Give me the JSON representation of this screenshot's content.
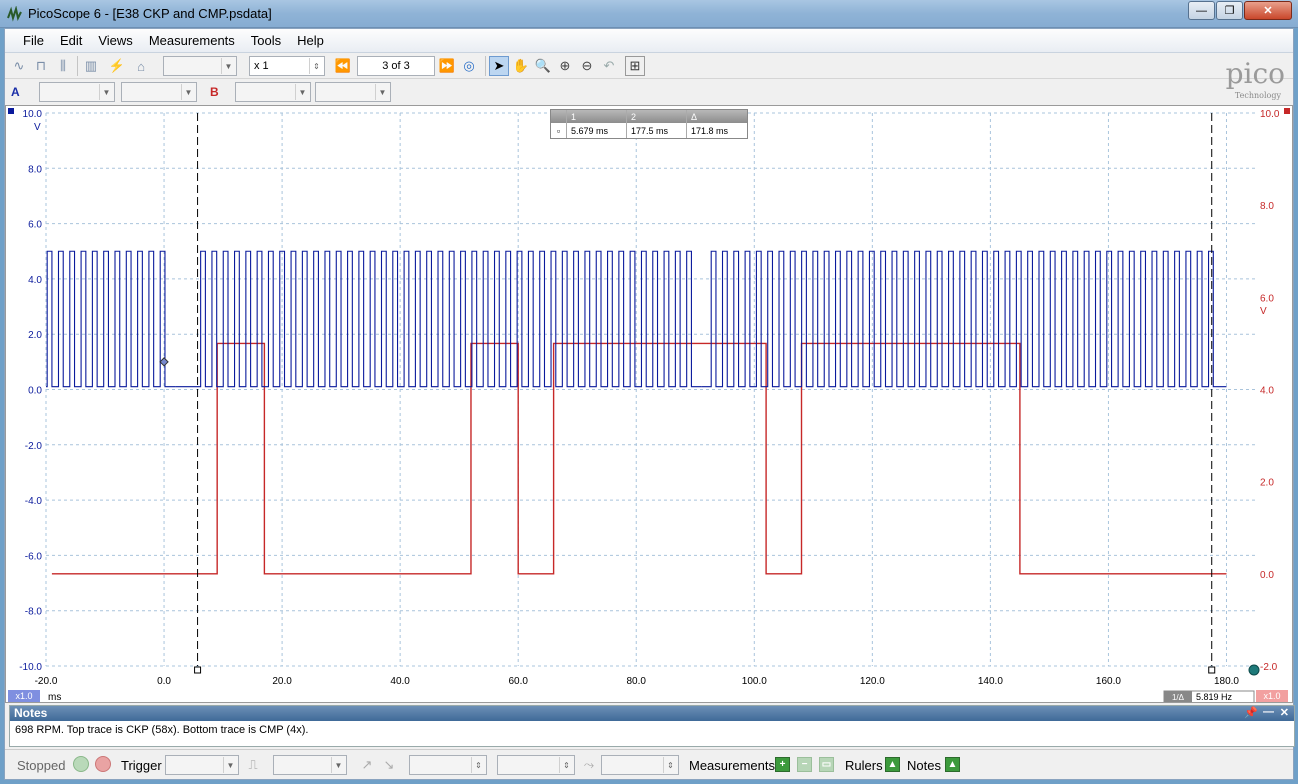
{
  "window": {
    "title": "PicoScope 6 - [E38 CKP and CMP.psdata]",
    "min_label": "—",
    "max_label": "❐",
    "close_label": "✕"
  },
  "menu": [
    "File",
    "Edit",
    "Views",
    "Measurements",
    "Tools",
    "Help"
  ],
  "toolbar1": {
    "zoom_factor": "x 1",
    "buffer_nav": "3 of 3"
  },
  "logo": {
    "word": "pico",
    "sub": "Technology"
  },
  "channels": {
    "a_label": "A",
    "b_label": "B"
  },
  "colors": {
    "channel_a": "#0a1a9c",
    "channel_b": "#c62828",
    "grid": "#a9c4dc"
  },
  "rulers": {
    "headers": [
      "1",
      "2",
      "Δ"
    ],
    "values": [
      "5.679 ms",
      "177.5 ms",
      "171.8 ms"
    ]
  },
  "axes": {
    "left_unit": "V",
    "right_unit": "V",
    "left_ticks": [
      "10.0",
      "8.0",
      "6.0",
      "4.0",
      "2.0",
      "0.0",
      "-2.0",
      "-4.0",
      "-6.0",
      "-8.0",
      "-10.0"
    ],
    "right_ticks": [
      "10.0",
      "8.0",
      "6.0",
      "4.0",
      "2.0",
      "0.0",
      "-2.0"
    ],
    "x_ticks": [
      "-20.0",
      "0.0",
      "20.0",
      "40.0",
      "60.0",
      "80.0",
      "100.0",
      "120.0",
      "140.0",
      "160.0",
      "180.0"
    ],
    "x_unit": "ms",
    "left_scale_badge": "x1.0",
    "right_scale_badge": "x1.0",
    "freq_readout": "5.819 Hz",
    "freq_prefix": "1/Δ"
  },
  "chart_data": {
    "type": "line",
    "x_range": [
      -20,
      185
    ],
    "y_range_a": [
      -10,
      10
    ],
    "y_range_b": [
      -2,
      10
    ],
    "series": [
      {
        "name": "A",
        "high": 5.0,
        "low": 0.1,
        "segments": [
          [
            -20,
            2
          ],
          [
            6,
            91
          ],
          [
            92.5,
            180
          ]
        ],
        "period_ms": 1.915
      },
      {
        "name": "B",
        "high": 5.0,
        "low": 0.0,
        "pulses": [
          [
            9,
            17
          ],
          [
            52,
            60
          ],
          [
            66,
            102
          ],
          [
            108,
            145
          ]
        ]
      }
    ],
    "ruler_x": [
      5.679,
      177.5
    ]
  },
  "notes": {
    "title": "Notes",
    "text": "698 RPM.  Top trace is CKP (58x).  Bottom trace is CMP (4x)."
  },
  "status": {
    "state": "Stopped",
    "trigger_label": "Trigger",
    "measurements_label": "Measurements",
    "rulers_label": "Rulers",
    "notes_label": "Notes"
  }
}
